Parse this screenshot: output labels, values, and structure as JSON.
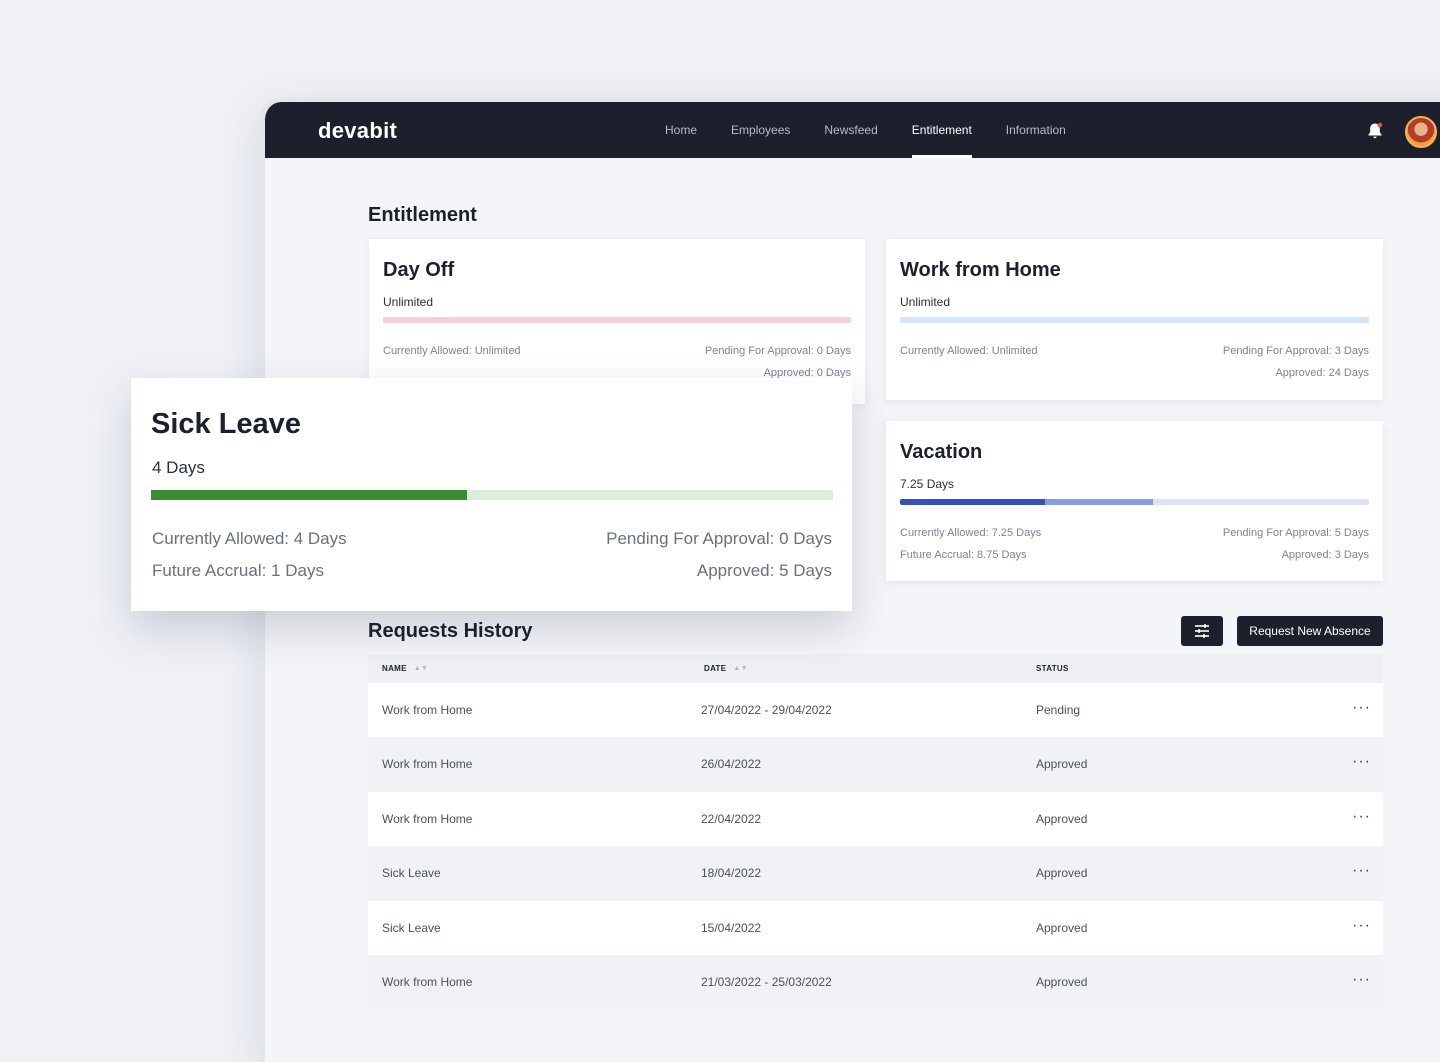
{
  "app": {
    "logo": "devabit",
    "nav": [
      {
        "label": "Home",
        "active": false
      },
      {
        "label": "Employees",
        "active": false
      },
      {
        "label": "Newsfeed",
        "active": false
      },
      {
        "label": "Entitlement",
        "active": true
      },
      {
        "label": "Information",
        "active": false
      }
    ],
    "icons": {
      "notifications": "bell-icon",
      "profile": "avatar"
    }
  },
  "page": {
    "title": "Entitlement"
  },
  "cards": {
    "day_off": {
      "title": "Day Off",
      "subtitle": "Unlimited",
      "left_1": "Currently Allowed: Unlimited",
      "right_1": "Pending For Approval: 0 Days",
      "right_2": "Approved: 0 Days",
      "bar_color": "#f5cfd4"
    },
    "wfh": {
      "title": "Work from Home",
      "subtitle": "Unlimited",
      "left_1": "Currently Allowed: Unlimited",
      "right_1": "Pending For Approval: 3 Days",
      "right_2": "Approved: 24 Days",
      "bar_color": "#d6e6f8"
    },
    "vacation": {
      "title": "Vacation",
      "subtitle": "7.25 Days",
      "left_1": "Currently Allowed: 7.25 Days",
      "left_2": "Future Accrual: 8.75 Days",
      "right_1": "Pending For Approval: 5 Days",
      "right_2": "Approved: 3 Days",
      "bar_colors": [
        "#3b4fb8",
        "#8a9ae0",
        "#dde3f5"
      ],
      "bar_fractions": [
        0.31,
        0.23
      ]
    },
    "sick_leave": {
      "title": "Sick Leave",
      "subtitle": "4 Days",
      "left_1": "Currently Allowed: 4 Days",
      "left_2": "Future Accrual: 1 Days",
      "right_1": "Pending For Approval: 0 Days",
      "right_2": "Approved: 5 Days",
      "bar_colors": [
        "#3b8d33",
        "#dceedb"
      ],
      "bar_fraction": 0.464
    }
  },
  "requests": {
    "title": "Requests History",
    "request_button": "Request New Absence",
    "filter_icon": "sliders-icon",
    "columns": [
      "NAME",
      "DATE",
      "STATUS"
    ],
    "rows": [
      {
        "name": "Work from Home",
        "date": "27/04/2022 - 29/04/2022",
        "status": "Pending"
      },
      {
        "name": "Work from Home",
        "date": "26/04/2022",
        "status": "Approved"
      },
      {
        "name": "Work from Home",
        "date": "22/04/2022",
        "status": "Approved"
      },
      {
        "name": "Sick Leave",
        "date": "18/04/2022",
        "status": "Approved"
      },
      {
        "name": "Sick Leave",
        "date": "15/04/2022",
        "status": "Approved"
      },
      {
        "name": "Work from Home",
        "date": "21/03/2022 - 25/03/2022",
        "status": "Approved"
      }
    ],
    "row_action": "···"
  }
}
